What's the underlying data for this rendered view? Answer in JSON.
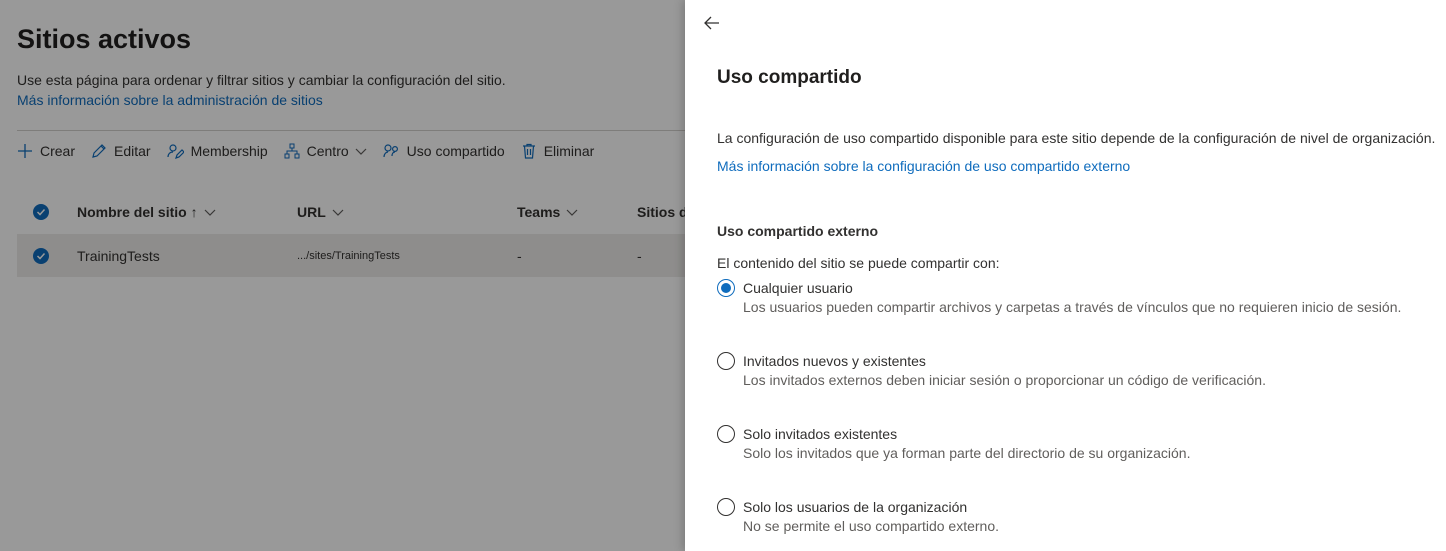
{
  "page": {
    "title": "Sitios activos",
    "description": "Use esta página para ordenar y filtrar sitios y cambiar la configuración del sitio.",
    "help_link": "Más información sobre la administración de sitios"
  },
  "toolbar": {
    "create_label": "Crear",
    "edit_label": "Editar",
    "membership_label": "Membership",
    "hub_label": "Centro",
    "sharing_label": "Uso compartido",
    "delete_label": "Eliminar"
  },
  "table": {
    "columns": [
      "Nombre del sitio ↑",
      "URL",
      "Teams",
      "Sitios d"
    ],
    "rows": [
      {
        "name": "TrainingTests",
        "url": ".../sites/TrainingTests",
        "teams": "-",
        "sites": "-"
      }
    ]
  },
  "panel": {
    "title": "Uso compartido",
    "description": "La configuración de uso compartido disponible para este sitio depende de la configuración de nivel de organización.",
    "link": "Más información sobre la configuración de uso compartido externo",
    "section_title": "Uso compartido externo",
    "section_subtitle": "El contenido del sitio se puede compartir con:",
    "options": [
      {
        "label": "Cualquier usuario",
        "desc": "Los usuarios pueden compartir archivos y carpetas a través de vínculos que no requieren inicio de sesión.",
        "selected": true
      },
      {
        "label": "Invitados nuevos y existentes",
        "desc": "Los invitados externos deben iniciar sesión o proporcionar un código de verificación.",
        "selected": false
      },
      {
        "label": "Solo invitados existentes",
        "desc": "Solo los invitados que ya forman parte del directorio de su organización.",
        "selected": false
      },
      {
        "label": "Solo los usuarios de la organización",
        "desc": "No se permite el uso compartido externo.",
        "selected": false
      }
    ]
  },
  "colors": {
    "accent": "#0f6cbd",
    "text": "#323130",
    "overlay": "rgba(0,0,0,0.40)"
  }
}
